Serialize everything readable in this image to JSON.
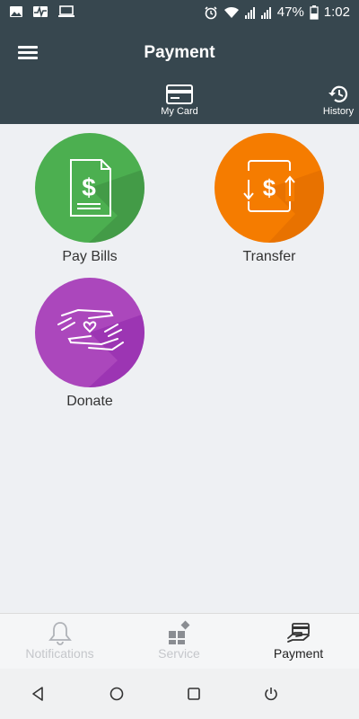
{
  "status_bar": {
    "battery": "47%",
    "time": "1:02",
    "icons": [
      "image-icon",
      "pulse-icon",
      "laptop-icon",
      "alarm-icon",
      "wifi-icon",
      "signal-icon",
      "signal-icon",
      "battery-icon"
    ]
  },
  "app_bar": {
    "title": "Payment",
    "tabs": [
      {
        "label": "My Card",
        "icon": "card-icon"
      },
      {
        "label": "History",
        "icon": "history-icon"
      }
    ]
  },
  "grid": [
    {
      "label": "Pay Bills",
      "icon": "bill-icon",
      "color": "#4caf50"
    },
    {
      "label": "Transfer",
      "icon": "transfer-icon",
      "color": "#f57c00"
    },
    {
      "label": "Donate",
      "icon": "donate-icon",
      "color": "#ab47bc"
    }
  ],
  "bottom_nav": [
    {
      "label": "Notifications",
      "icon": "bell-icon",
      "active": false
    },
    {
      "label": "Service",
      "icon": "service-icon",
      "active": false
    },
    {
      "label": "Payment",
      "icon": "payment-icon",
      "active": true
    }
  ],
  "colors": {
    "header": "#37474f",
    "background": "#eef0f3",
    "inactive_nav": "#c5c7cb",
    "active_nav": "#222222"
  }
}
